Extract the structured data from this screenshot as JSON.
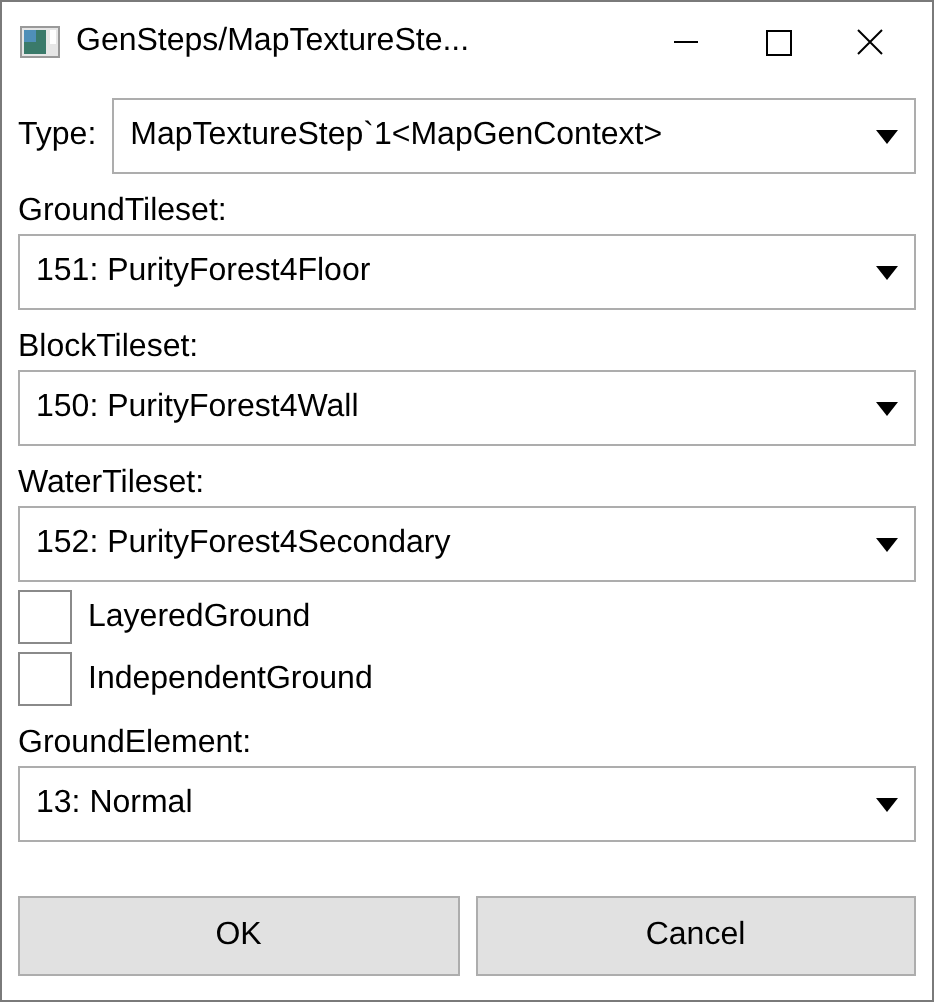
{
  "window": {
    "title": "GenSteps/MapTextureSte..."
  },
  "type_field": {
    "label": "Type:",
    "value": "MapTextureStep`1<MapGenContext>"
  },
  "fields": [
    {
      "kind": "combo",
      "label": "GroundTileset:",
      "value": "151: PurityForest4Floor"
    },
    {
      "kind": "combo",
      "label": "BlockTileset:",
      "value": "150: PurityForest4Wall"
    },
    {
      "kind": "combo",
      "label": "WaterTileset:",
      "value": "152: PurityForest4Secondary"
    },
    {
      "kind": "checkbox",
      "label": "LayeredGround",
      "checked": false
    },
    {
      "kind": "checkbox",
      "label": "IndependentGround",
      "checked": false
    },
    {
      "kind": "combo",
      "label": "GroundElement:",
      "value": "13: Normal"
    }
  ],
  "buttons": [
    "OK",
    "Cancel"
  ]
}
